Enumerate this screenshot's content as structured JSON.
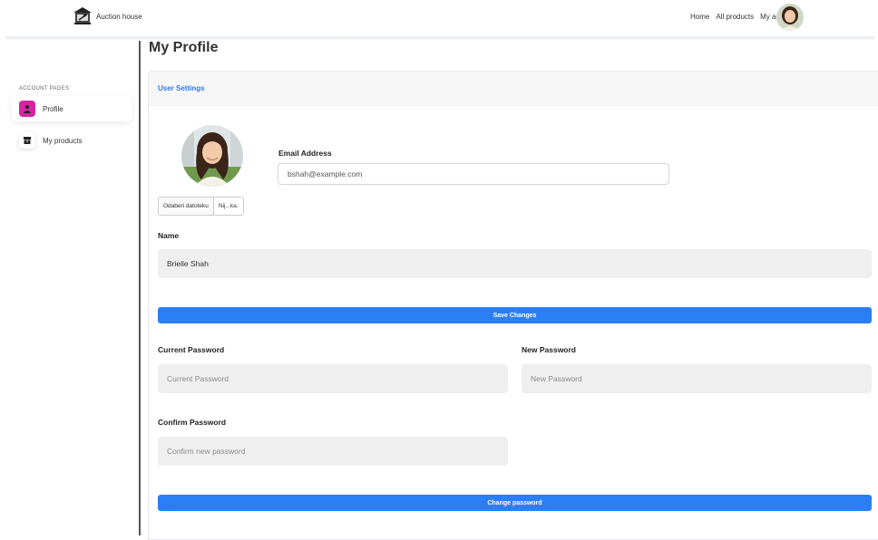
{
  "header": {
    "brand": "Auction house",
    "nav": [
      "Home",
      "All products",
      "My account"
    ]
  },
  "sidebar": {
    "heading": "ACCOUNT PAGES",
    "items": [
      {
        "label": "Profile",
        "icon": "user-icon",
        "active": true
      },
      {
        "label": "My products",
        "icon": "box-icon",
        "active": false
      }
    ]
  },
  "main": {
    "title": "My Profile",
    "card_title": "User Settings",
    "file_choose_label": "Odaberi datoteku",
    "file_name": "Nij...ka.",
    "email_label": "Email Address",
    "email_value": "bshah@example.com",
    "name_label": "Name",
    "name_value": "Brielle Shah",
    "save_button": "Save Changes",
    "current_password_label": "Current Password",
    "current_password_placeholder": "Current Password",
    "new_password_label": "New Password",
    "new_password_placeholder": "New Password",
    "confirm_password_label": "Confirm Password",
    "confirm_password_placeholder": "Confirm new password",
    "change_password_button": "Change password"
  },
  "colors": {
    "accent": "#2b7ff6",
    "active_icon": "#d6249f",
    "input_bg": "#efefef"
  }
}
